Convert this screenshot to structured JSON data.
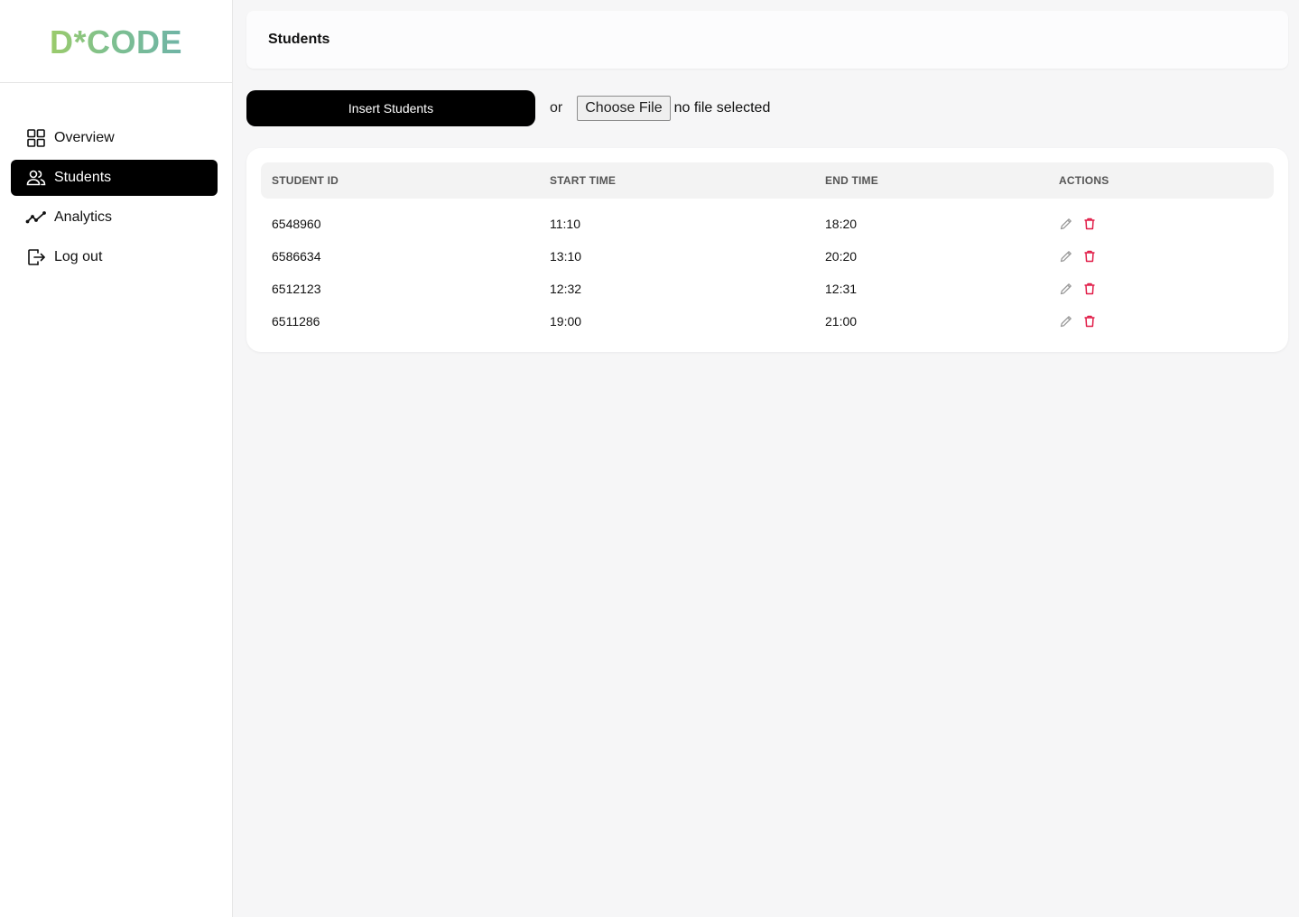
{
  "brand": {
    "logo": "D*CODE"
  },
  "sidebar": {
    "items": [
      {
        "label": "Overview",
        "icon": "grid-icon",
        "active": false
      },
      {
        "label": "Students",
        "icon": "users-icon",
        "active": true
      },
      {
        "label": "Analytics",
        "icon": "trend-icon",
        "active": false
      },
      {
        "label": "Log out",
        "icon": "logout-icon",
        "active": false
      }
    ]
  },
  "header": {
    "title": "Students"
  },
  "toolbar": {
    "insert_label": "Insert Students",
    "or_text": "or",
    "file_button": "Choose File",
    "file_status": "no file selected"
  },
  "table": {
    "columns": [
      "STUDENT ID",
      "START TIME",
      "END TIME",
      "ACTIONS"
    ],
    "rows": [
      {
        "id": "6548960",
        "start": "11:10",
        "end": "18:20"
      },
      {
        "id": "6586634",
        "start": "13:10",
        "end": "20:20"
      },
      {
        "id": "6512123",
        "start": "12:32",
        "end": "12:31"
      },
      {
        "id": "6511286",
        "start": "19:00",
        "end": "21:00"
      }
    ]
  },
  "colors": {
    "accent": "#000000",
    "delete": "#e11d48",
    "edit": "#9a9a9a",
    "logo_start": "#9bcb6b",
    "logo_end": "#6fb4a6"
  }
}
